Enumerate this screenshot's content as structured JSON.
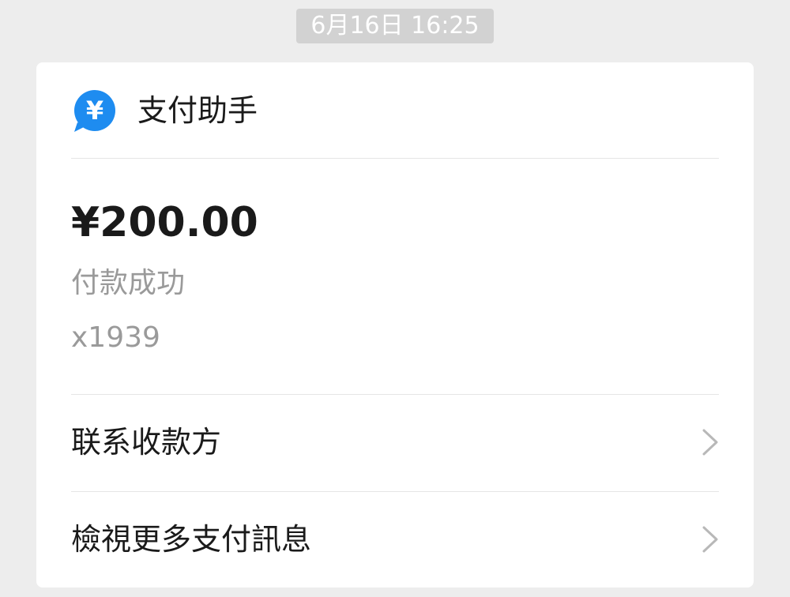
{
  "timestamp": "6月16日 16:25",
  "app": {
    "name": "支付助手",
    "icon": "yen-bubble-icon",
    "icon_symbol": "¥",
    "icon_color": "#1e8cf0"
  },
  "payment": {
    "amount": "¥200.00",
    "status": "付款成功",
    "reference": "x1939"
  },
  "actions": [
    {
      "label": "联系收款方",
      "icon": "chevron-right-icon"
    },
    {
      "label": "檢視更多支付訊息",
      "icon": "chevron-right-icon"
    }
  ]
}
